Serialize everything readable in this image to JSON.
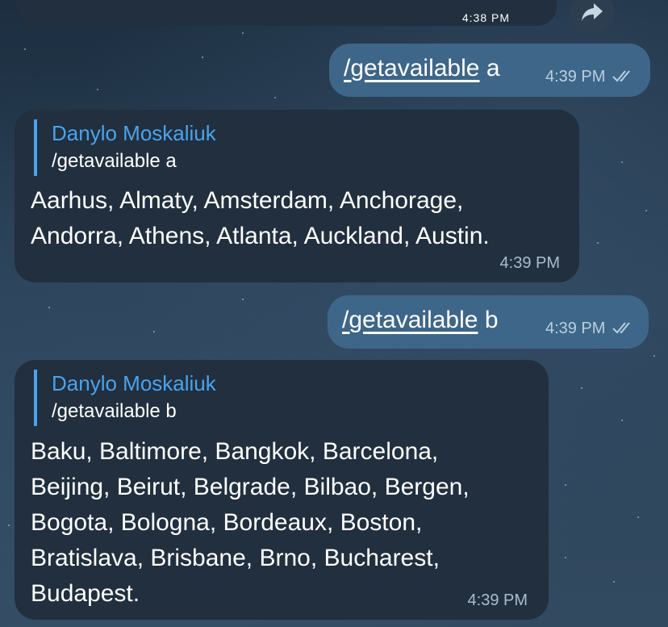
{
  "photo_message": {
    "time": "4:38 PM"
  },
  "messages": [
    {
      "type": "outgoing",
      "command": "/getavailable",
      "arg": "a",
      "time": "4:39 PM"
    },
    {
      "type": "incoming",
      "reply_name": "Danylo Moskaliuk",
      "reply_text": "/getavailable a",
      "lines": [
        "Aarhus, Almaty, Amsterdam, Anchorage,",
        "Andorra, Athens, Atlanta, Auckland, Austin."
      ],
      "time": "4:39 PM"
    },
    {
      "type": "outgoing",
      "command": "/getavailable",
      "arg": "b",
      "time": "4:39 PM"
    },
    {
      "type": "incoming",
      "reply_name": "Danylo Moskaliuk",
      "reply_text": "/getavailable b",
      "lines": [
        "Baku, Baltimore, Bangkok, Barcelona,",
        "Beijing, Beirut, Belgrade, Bilbao, Bergen,",
        "Bogota, Bologna, Bordeaux, Boston,",
        "Bratislava, Brisbane, Brno, Bucharest,",
        "Budapest."
      ],
      "time": "4:39 PM"
    }
  ],
  "colors": {
    "incoming_bubble": "#212f3e",
    "outgoing_bubble": "#3e6688",
    "reply_accent": "#4aa3ec"
  }
}
